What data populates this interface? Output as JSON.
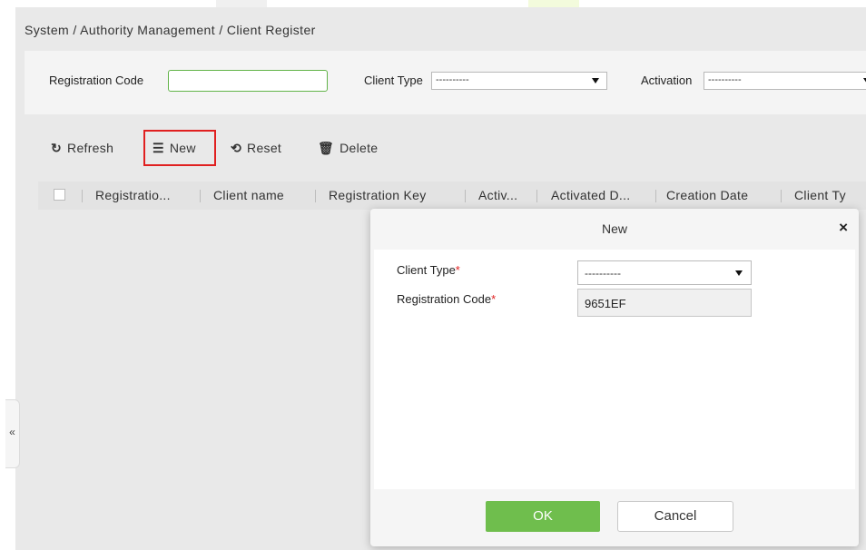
{
  "breadcrumb": "System / Authority Management / Client Register",
  "filters": {
    "registration_code_label": "Registration Code",
    "registration_code_value": "",
    "client_type_label": "Client Type",
    "client_type_value": "----------",
    "activation_label": "Activation",
    "activation_value": "----------"
  },
  "toolbar": {
    "refresh": "Refresh",
    "new": "New",
    "reset": "Reset",
    "delete": "Delete"
  },
  "table": {
    "columns": [
      "Registratio...",
      "Client name",
      "Registration Key",
      "Activ...",
      "Activated D...",
      "Creation Date",
      "Client Ty"
    ]
  },
  "sidebar": {
    "collapse_glyph": "«"
  },
  "dialog": {
    "title": "New",
    "close_glyph": "×",
    "client_type_label": "Client Type",
    "client_type_value": "----------",
    "registration_code_label": "Registration Code",
    "registration_code_value": "9651EF",
    "required_marker": "*",
    "ok_label": "OK",
    "cancel_label": "Cancel"
  },
  "colors": {
    "accent_green": "#6fbe4d",
    "highlight_red": "#e02020"
  }
}
